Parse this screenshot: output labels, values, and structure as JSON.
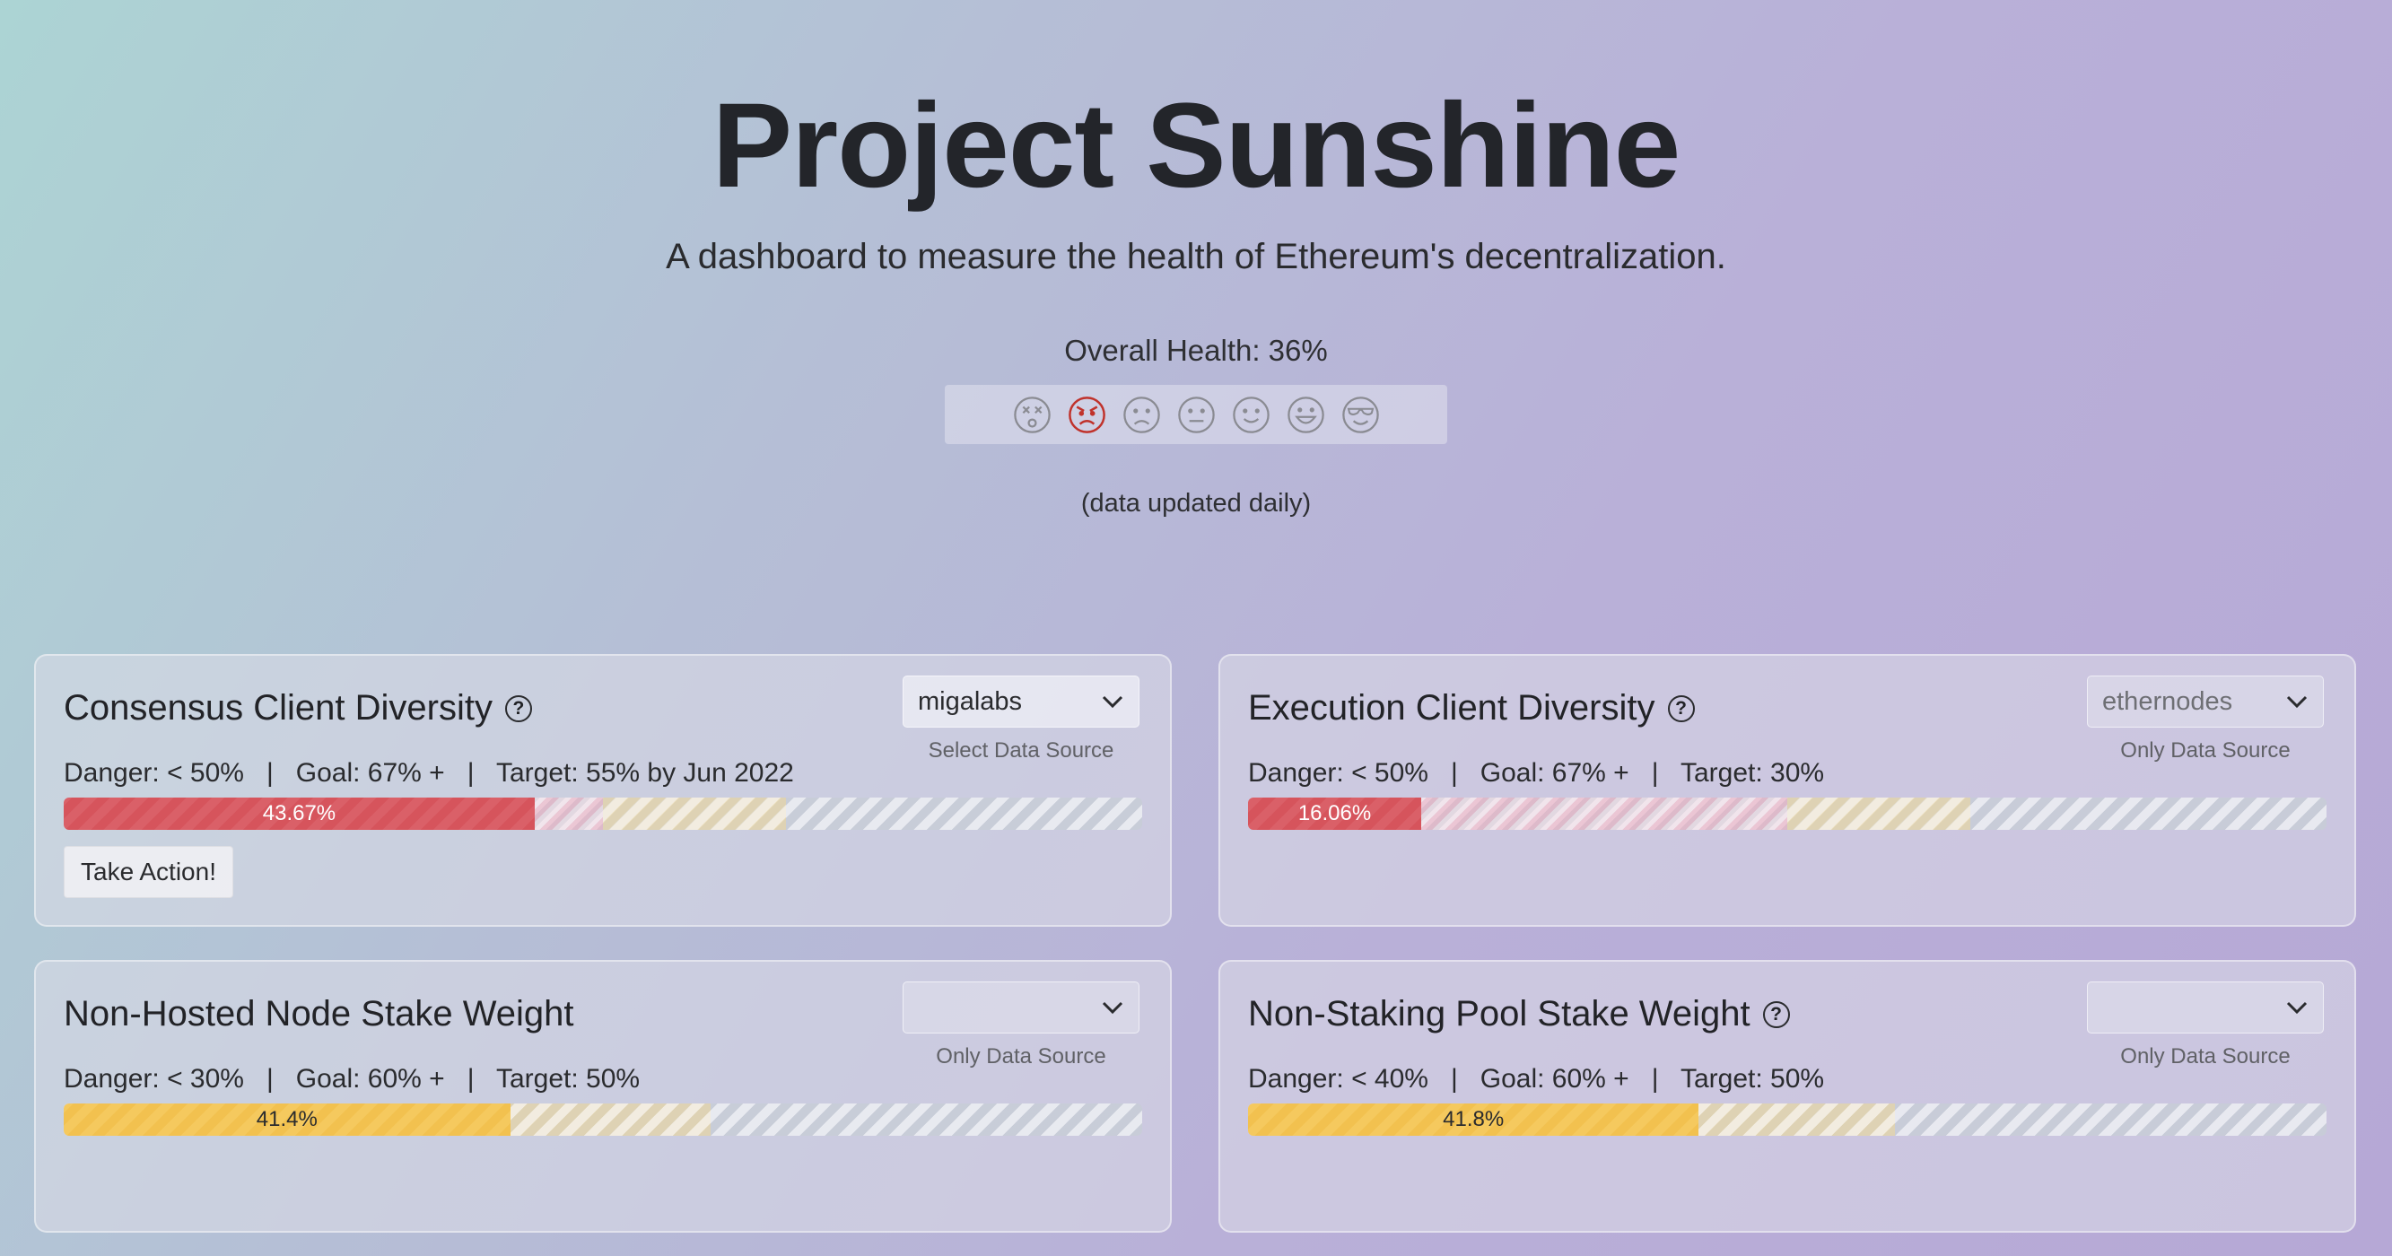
{
  "header": {
    "title": "Project Sunshine",
    "subtitle": "A dashboard to measure the health of Ethereum's decentralization.",
    "overall_health": "Overall Health: 36%",
    "overall_health_percent": 36,
    "updated_note": "(data updated daily)"
  },
  "health_scale": {
    "faces": [
      {
        "icon": "dizzy-face-icon",
        "active": false
      },
      {
        "icon": "angry-face-icon",
        "active": true
      },
      {
        "icon": "sad-face-icon",
        "active": false
      },
      {
        "icon": "neutral-face-icon",
        "active": false
      },
      {
        "icon": "smile-face-icon",
        "active": false
      },
      {
        "icon": "grin-face-icon",
        "active": false
      },
      {
        "icon": "sunglasses-face-icon",
        "active": false
      }
    ],
    "active_color": "#c0322b",
    "inactive_color": "#8a8b92"
  },
  "cards": [
    {
      "title": "Consensus Client Diversity",
      "has_help": true,
      "select_value": "migalabs",
      "select_caption": "Select Data Source",
      "stats": "Danger: < 50%   |   Goal: 67% +   |   Target: 55% by Jun 2022",
      "value_label": "43.67%",
      "value": 43.67,
      "danger": 50,
      "goal": 67,
      "color": "red",
      "action": "Take Action!"
    },
    {
      "title": "Execution Client Diversity",
      "has_help": true,
      "select_value": "ethernodes",
      "select_caption": "Only Data Source",
      "stats": "Danger: < 50%   |   Goal: 67% +   |   Target: 30%",
      "value_label": "16.06%",
      "value": 16.06,
      "danger": 50,
      "goal": 67,
      "color": "red"
    },
    {
      "title": "Non-Hosted Node Stake Weight",
      "has_help": false,
      "select_value": "",
      "select_caption": "Only Data Source",
      "stats": "Danger: < 30%   |   Goal: 60% +   |   Target: 50%",
      "value_label": "41.4%",
      "value": 41.4,
      "danger": 30,
      "goal": 60,
      "color": "yellow"
    },
    {
      "title": "Non-Staking Pool Stake Weight",
      "has_help": true,
      "select_value": "",
      "select_caption": "Only Data Source",
      "stats": "Danger: < 40%   |   Goal: 60% +   |   Target: 50%",
      "value_label": "41.8%",
      "value": 41.8,
      "danger": 40,
      "goal": 60,
      "color": "yellow"
    }
  ]
}
